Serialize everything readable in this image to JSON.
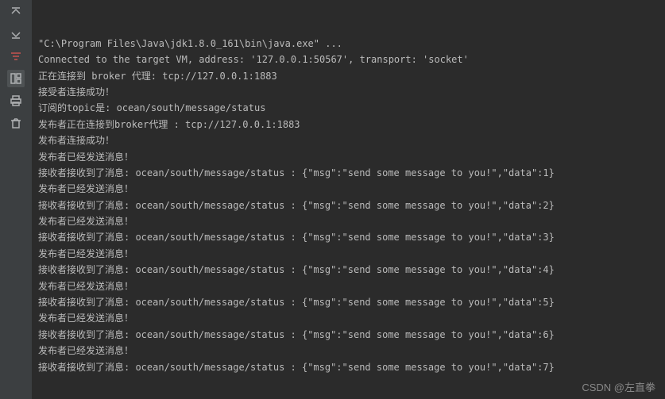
{
  "sidebar": {
    "icons": [
      {
        "name": "expand-up-icon"
      },
      {
        "name": "expand-down-icon"
      },
      {
        "name": "filter-icon"
      },
      {
        "name": "layout-icon"
      },
      {
        "name": "print-icon"
      },
      {
        "name": "trash-icon"
      }
    ]
  },
  "console": {
    "lines": [
      "\"C:\\Program Files\\Java\\jdk1.8.0_161\\bin\\java.exe\" ...",
      "Connected to the target VM, address: '127.0.0.1:50567', transport: 'socket'",
      "正在连接到 broker 代理: tcp://127.0.0.1:1883",
      "接受者连接成功！",
      "订阅的topic是: ocean/south/message/status",
      "发布者正在连接到broker代理 : tcp://127.0.0.1:1883",
      "发布者连接成功！",
      "发布者已经发送消息！",
      "接收者接收到了消息: ocean/south/message/status : {\"msg\":\"send some message to you!\",\"data\":1}",
      "发布者已经发送消息！",
      "接收者接收到了消息: ocean/south/message/status : {\"msg\":\"send some message to you!\",\"data\":2}",
      "发布者已经发送消息！",
      "接收者接收到了消息: ocean/south/message/status : {\"msg\":\"send some message to you!\",\"data\":3}",
      "发布者已经发送消息！",
      "接收者接收到了消息: ocean/south/message/status : {\"msg\":\"send some message to you!\",\"data\":4}",
      "发布者已经发送消息！",
      "接收者接收到了消息: ocean/south/message/status : {\"msg\":\"send some message to you!\",\"data\":5}",
      "发布者已经发送消息！",
      "接收者接收到了消息: ocean/south/message/status : {\"msg\":\"send some message to you!\",\"data\":6}",
      "发布者已经发送消息！",
      "接收者接收到了消息: ocean/south/message/status : {\"msg\":\"send some message to you!\",\"data\":7}"
    ]
  },
  "watermark": "CSDN @左直拳"
}
